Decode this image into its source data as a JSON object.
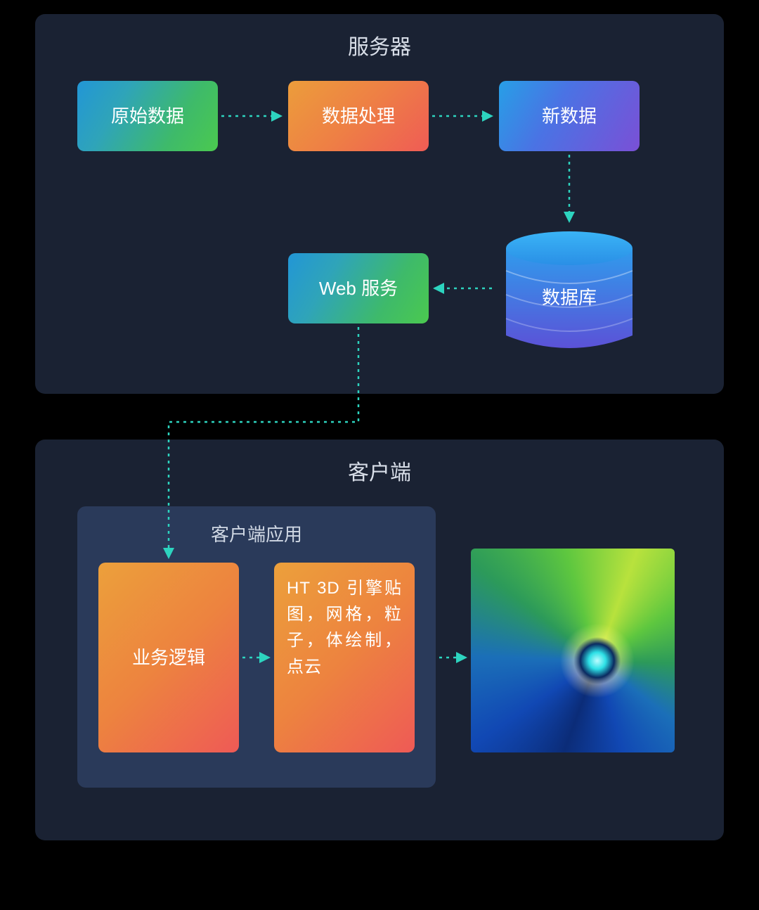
{
  "server": {
    "title": "服务器",
    "nodes": {
      "raw_data": "原始数据",
      "processing": "数据处理",
      "new_data": "新数据",
      "database": "数据库",
      "web_service": "Web 服务"
    }
  },
  "client": {
    "title": "客户端",
    "app_title": "客户端应用",
    "nodes": {
      "business_logic": "业务逻辑",
      "ht_engine": "HT 3D 引擎贴图，网格，粒子，体绘制，点云"
    }
  },
  "colors": {
    "arrow": "#2dd4bf",
    "db_grad_top": "#2aa5ef",
    "db_grad_bot": "#5b52d7"
  }
}
